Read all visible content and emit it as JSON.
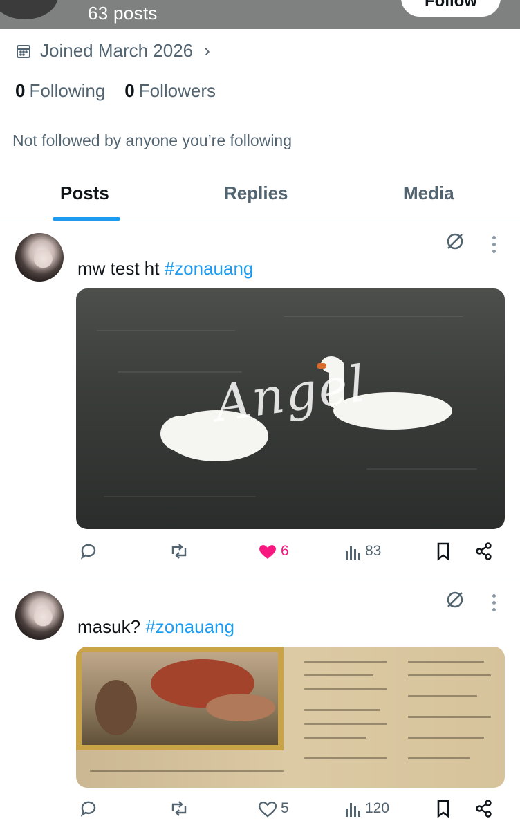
{
  "header": {
    "posts_count": "63 posts",
    "back_icon": "arrow-left-icon",
    "follow_label": "Follow"
  },
  "profile": {
    "joined": "Joined March 2026",
    "following_count": "0",
    "following_label": "Following",
    "followers_count": "0",
    "followers_label": "Followers",
    "not_followed_text": "Not followed by anyone you’re following"
  },
  "tabs": [
    {
      "label": "Posts",
      "active": true
    },
    {
      "label": "Replies",
      "active": false
    },
    {
      "label": "Media",
      "active": false
    }
  ],
  "posts": [
    {
      "text": "mw test ht ",
      "hashtag": "#zonauang",
      "media_watermark": "Angel",
      "likes": "6",
      "liked": true,
      "views": "83"
    },
    {
      "text": "masuk? ",
      "hashtag": "#zonauang",
      "likes": "5",
      "liked": false,
      "views": "120"
    }
  ],
  "colors": {
    "accent": "#1d9bf0",
    "like": "#f91880",
    "muted": "#536471",
    "header_bg": "#7f8080"
  }
}
